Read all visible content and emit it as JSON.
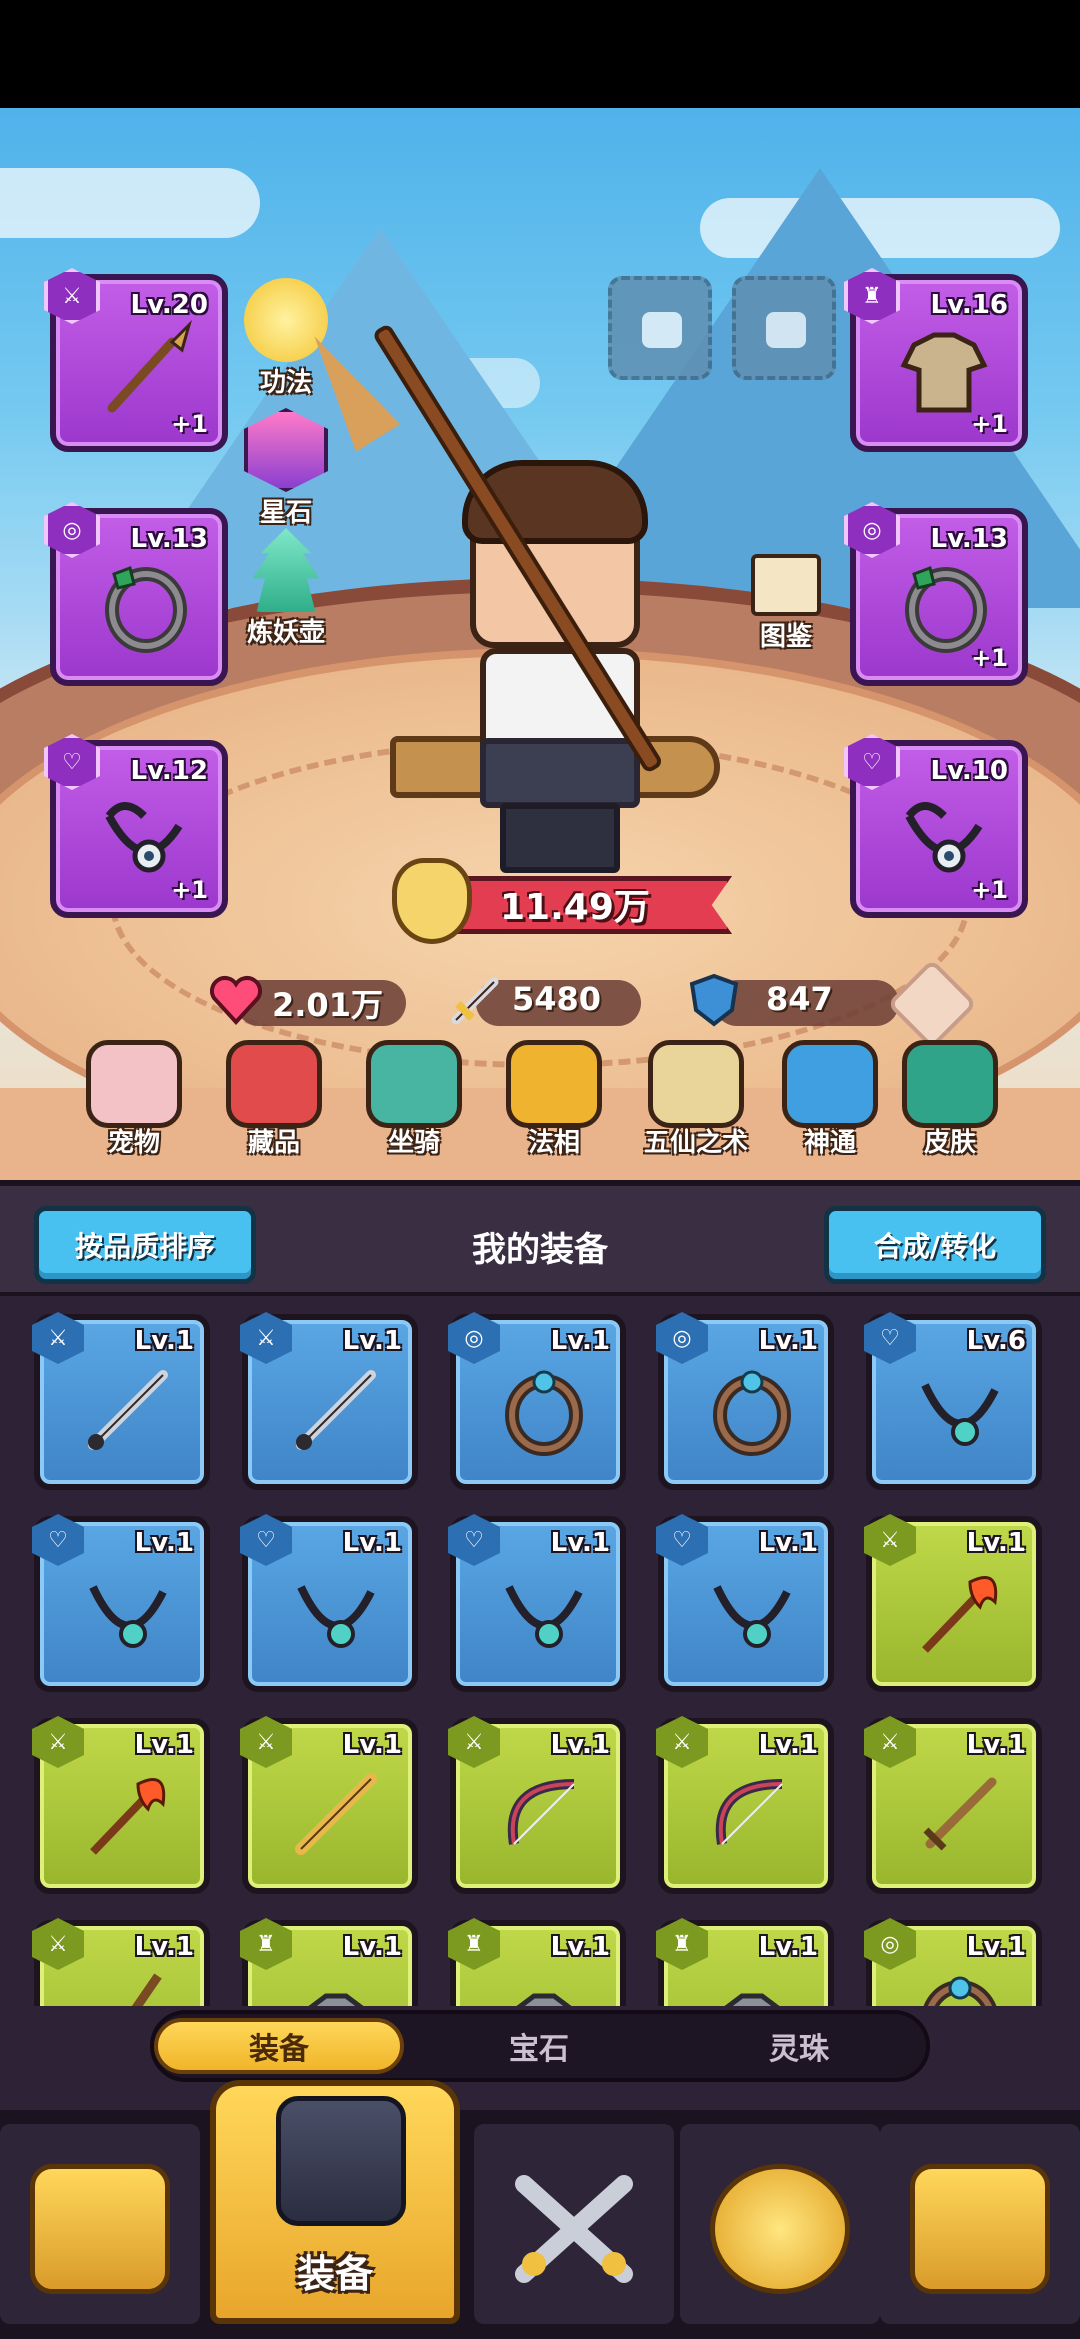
{
  "equip_slots_left": [
    {
      "level": "Lv.20",
      "plus": "+1",
      "item": "spear",
      "slot": "weapon"
    },
    {
      "level": "Lv.13",
      "plus": "",
      "item": "ring",
      "slot": "ring"
    },
    {
      "level": "Lv.12",
      "plus": "+1",
      "item": "necklace",
      "slot": "necklace"
    }
  ],
  "equip_slots_right": [
    {
      "level": "Lv.16",
      "plus": "+1",
      "item": "armor",
      "slot": "armor"
    },
    {
      "level": "Lv.13",
      "plus": "+1",
      "item": "ring",
      "slot": "ring"
    },
    {
      "level": "Lv.10",
      "plus": "+1",
      "item": "necklace",
      "slot": "necklace"
    }
  ],
  "side_buttons": [
    {
      "label": "功法",
      "icon": "trophy-icon"
    },
    {
      "label": "星石",
      "icon": "star-stone-icon"
    },
    {
      "label": "炼妖壶",
      "icon": "pagoda-icon"
    },
    {
      "label": "图鉴",
      "icon": "book-icon"
    }
  ],
  "power": "11.49万",
  "stats": {
    "hp": "2.01万",
    "attack": "5480",
    "defense": "847"
  },
  "quick_menu": [
    {
      "label": "宠物",
      "icon": "pet-icon",
      "color": "#f3c2c6"
    },
    {
      "label": "藏品",
      "icon": "treasure-chest-icon",
      "color": "#e24b4b"
    },
    {
      "label": "坐骑",
      "icon": "mount-icon",
      "color": "#48b5a3"
    },
    {
      "label": "法相",
      "icon": "lamp-icon",
      "color": "#f0b32f"
    },
    {
      "label": "五仙之术",
      "icon": "scroll-icon",
      "color": "#e9d59a"
    },
    {
      "label": "神通",
      "icon": "spellbook-icon",
      "color": "#3f9fe0"
    },
    {
      "label": "皮肤",
      "icon": "helmet-icon",
      "color": "#2fa489"
    }
  ],
  "panel": {
    "sort_button": "按品质排序",
    "title": "我的装备",
    "convert_button": "合成/转化"
  },
  "inventory": [
    {
      "level": "Lv.1",
      "rarity": "blue",
      "item": "sword"
    },
    {
      "level": "Lv.1",
      "rarity": "blue",
      "item": "sword"
    },
    {
      "level": "Lv.1",
      "rarity": "blue",
      "item": "ring"
    },
    {
      "level": "Lv.1",
      "rarity": "blue",
      "item": "ring"
    },
    {
      "level": "Lv.6",
      "rarity": "blue",
      "item": "necklace"
    },
    {
      "level": "Lv.1",
      "rarity": "blue",
      "item": "necklace"
    },
    {
      "level": "Lv.1",
      "rarity": "blue",
      "item": "necklace"
    },
    {
      "level": "Lv.1",
      "rarity": "blue",
      "item": "necklace"
    },
    {
      "level": "Lv.1",
      "rarity": "blue",
      "item": "necklace"
    },
    {
      "level": "Lv.1",
      "rarity": "green",
      "item": "flame-spear"
    },
    {
      "level": "Lv.1",
      "rarity": "green",
      "item": "flame-spear"
    },
    {
      "level": "Lv.1",
      "rarity": "green",
      "item": "golden-sword"
    },
    {
      "level": "Lv.1",
      "rarity": "green",
      "item": "bow"
    },
    {
      "level": "Lv.1",
      "rarity": "green",
      "item": "bow"
    },
    {
      "level": "Lv.1",
      "rarity": "green",
      "item": "wooden-sword"
    },
    {
      "level": "Lv.1",
      "rarity": "green",
      "item": "staff"
    },
    {
      "level": "Lv.1",
      "rarity": "green",
      "item": "armor"
    },
    {
      "level": "Lv.1",
      "rarity": "green",
      "item": "armor"
    },
    {
      "level": "Lv.1",
      "rarity": "green",
      "item": "armor"
    },
    {
      "level": "Lv.1",
      "rarity": "green",
      "item": "ring"
    }
  ],
  "subtabs": [
    "装备",
    "宝石",
    "灵珠"
  ],
  "bottom_nav": [
    {
      "label": "",
      "icon": "shop-icon"
    },
    {
      "label": "装备",
      "icon": "helmet-equipment-icon"
    },
    {
      "label": "",
      "icon": "crossed-swords-icon"
    },
    {
      "label": "",
      "icon": "upgrade-arrow-icon"
    },
    {
      "label": "",
      "icon": "locked-chest-icon"
    }
  ]
}
